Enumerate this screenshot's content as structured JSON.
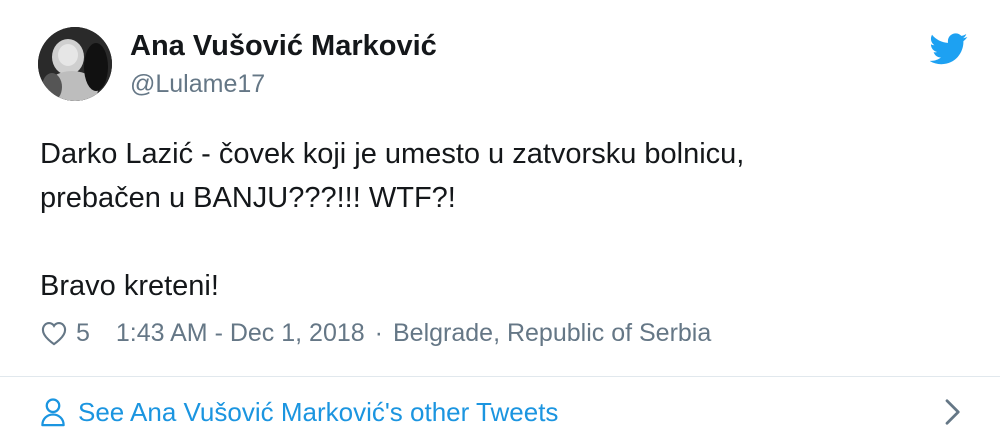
{
  "tweet": {
    "author": {
      "name": "Ana Vušović Marković",
      "handle": "@Lulame17",
      "avatar_icon": "profile-photo"
    },
    "brand_icon": "twitter-bird-icon",
    "brand_color": "#1da1f2",
    "text": {
      "line1": "Darko Lazić - čovek koji je umesto u zatvorsku bolnicu,",
      "line2": "prebačen u BANJU???!!! WTF?!",
      "line3": "Bravo kreteni!"
    },
    "meta": {
      "like_icon": "heart-icon",
      "likes": "5",
      "timestamp": "1:43 AM - Dec 1, 2018",
      "separator": "·",
      "location": "Belgrade, Republic of Serbia"
    },
    "footer": {
      "icon": "user-icon",
      "link_text": "See Ana Vušović Marković's other Tweets",
      "chevron_icon": "chevron-right-icon",
      "link_color": "#1b95e0"
    }
  }
}
